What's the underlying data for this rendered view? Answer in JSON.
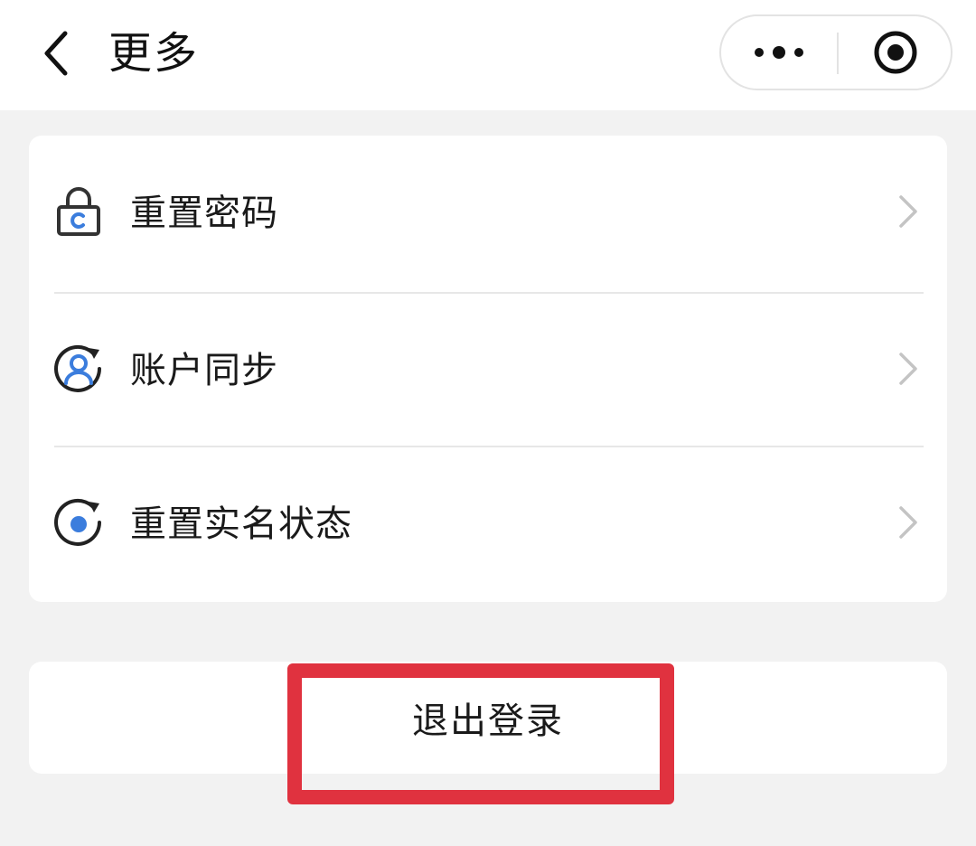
{
  "header": {
    "title": "更多",
    "back_icon": "chevron-left-icon",
    "capsule": {
      "more_icon": "more-dots-icon",
      "close_icon": "target-circle-icon"
    }
  },
  "menu": {
    "items": [
      {
        "label": "重置密码",
        "icon": "lock-reset-icon"
      },
      {
        "label": "账户同步",
        "icon": "account-sync-icon"
      },
      {
        "label": "重置实名状态",
        "icon": "reset-realname-icon"
      }
    ],
    "chevron_icon": "chevron-right-icon"
  },
  "logout": {
    "label": "退出登录"
  },
  "colors": {
    "accent_blue": "#3b7ddd",
    "highlight_red": "#e0323f",
    "background": "#f2f2f2"
  }
}
